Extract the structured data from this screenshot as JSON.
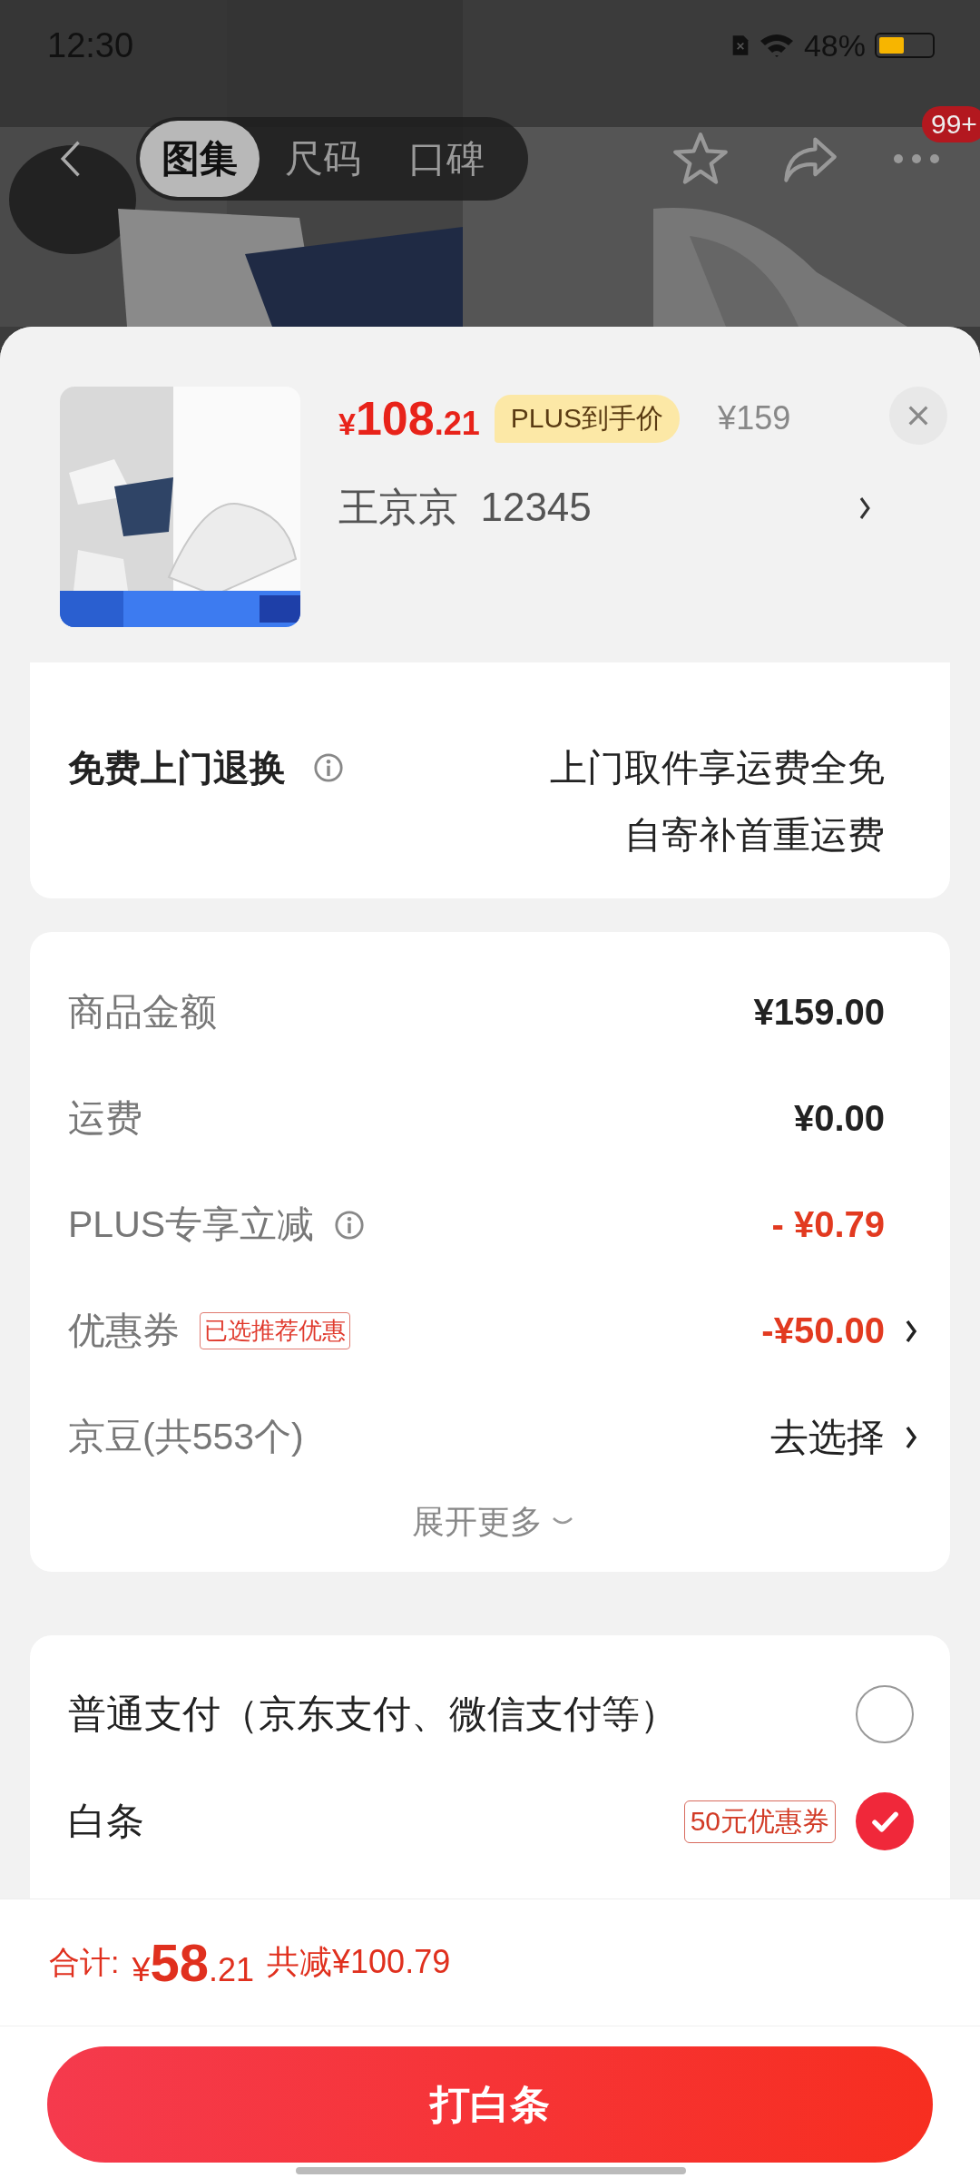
{
  "status_bar": {
    "time": "12:30",
    "battery": "48%"
  },
  "nav": {
    "tabs": [
      {
        "label": "图集",
        "selected": true
      },
      {
        "label": "尺码",
        "selected": false
      },
      {
        "label": "口碑",
        "selected": false
      }
    ],
    "badge": "99+"
  },
  "product": {
    "price_symbol": "¥",
    "price_int": "108",
    "price_dec": ".21",
    "plus_tag": "PLUS到手价",
    "original_price": "¥159",
    "spec": "王京京  12345"
  },
  "services": {
    "items": [
      {
        "name": "免费上门退换",
        "info": true,
        "lines": [
          "上门取件享运费全免",
          "自寄补首重运费"
        ]
      }
    ]
  },
  "fees": {
    "rows": [
      {
        "label": "商品金额",
        "info": false,
        "value": "¥159.00",
        "kind": "plain",
        "arrow": false
      },
      {
        "label": "运费",
        "info": false,
        "value": "¥0.00",
        "kind": "plain",
        "arrow": false
      },
      {
        "label": "PLUS专享立减",
        "info": true,
        "value": "- ¥0.79",
        "kind": "discount",
        "arrow": false
      },
      {
        "label": "优惠券",
        "info": false,
        "tag": "已选推荐优惠",
        "value": "-¥50.00",
        "kind": "discount",
        "arrow": true
      },
      {
        "label": "京豆(共553个)",
        "info": false,
        "value": "去选择",
        "kind": "action",
        "arrow": true
      }
    ],
    "more": "展开更多"
  },
  "payment": {
    "options": [
      {
        "label": "普通支付（京东支付、微信支付等）",
        "selected": false
      },
      {
        "label": "白条",
        "tag": "50元优惠券",
        "selected": true
      }
    ]
  },
  "footer": {
    "total_label": "合计:",
    "total_symbol": "¥",
    "total_int": "58",
    "total_dec": ".21",
    "saved": "共减¥100.79",
    "button": "打白条"
  }
}
